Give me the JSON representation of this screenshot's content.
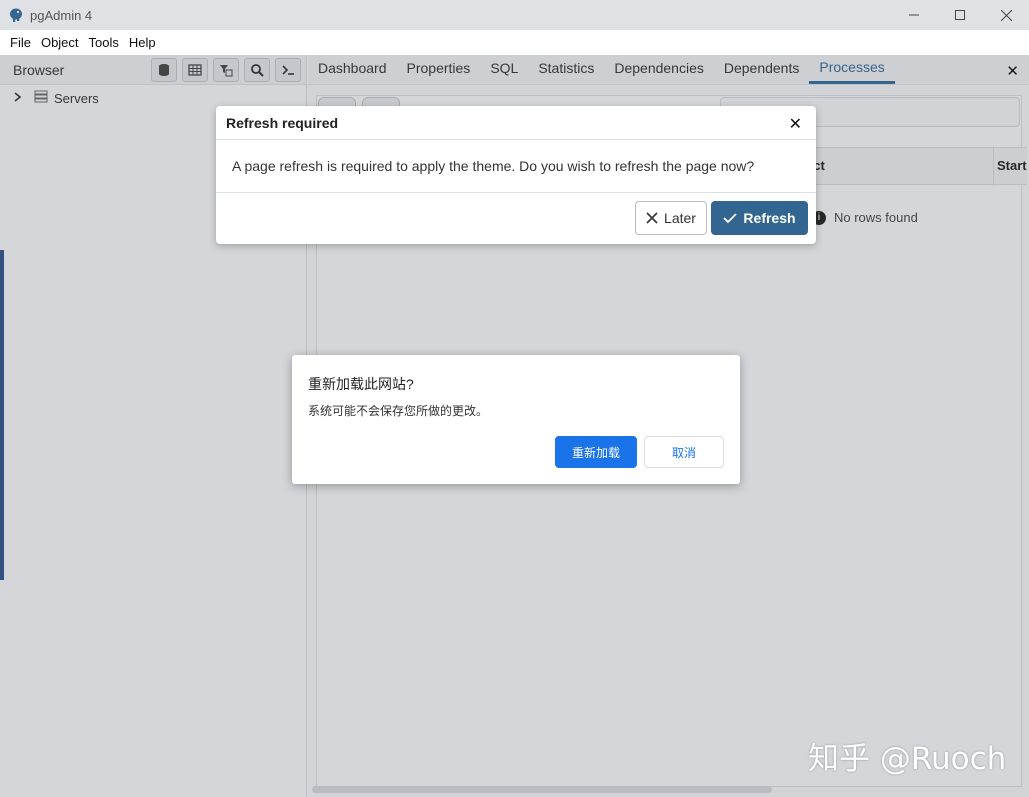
{
  "window": {
    "title": "pgAdmin 4",
    "controls": [
      "minimize",
      "maximize",
      "close"
    ]
  },
  "menu": [
    "File",
    "Object",
    "Tools",
    "Help"
  ],
  "browser": {
    "label": "Browser",
    "toolbar_icons": [
      "query-tool-icon",
      "view-data-icon",
      "filtered-rows-icon",
      "search-objects-icon",
      "psql-tool-icon"
    ],
    "tree": [
      {
        "label": "Servers",
        "expanded": false
      }
    ]
  },
  "tabs": {
    "items": [
      "Dashboard",
      "Properties",
      "SQL",
      "Statistics",
      "Dependencies",
      "Dependents",
      "Processes"
    ],
    "active": "Processes",
    "close_glyph": "✕"
  },
  "grid": {
    "columns": [
      "ect",
      "Start"
    ],
    "empty_message": "No rows found"
  },
  "refresh_dialog": {
    "title": "Refresh required",
    "close_glyph": "✕",
    "message": "A page refresh is required to apply the theme. Do you wish to refresh the page now?",
    "later_label": "Later",
    "refresh_label": "Refresh",
    "accent": "#326690"
  },
  "browser_dialog": {
    "title": "重新加载此网站?",
    "message": "系统可能不会保存您所做的更改。",
    "reload_label": "重新加载",
    "cancel_label": "取消",
    "accent": "#1a73e8"
  },
  "watermark": "知乎 @Ruoch"
}
